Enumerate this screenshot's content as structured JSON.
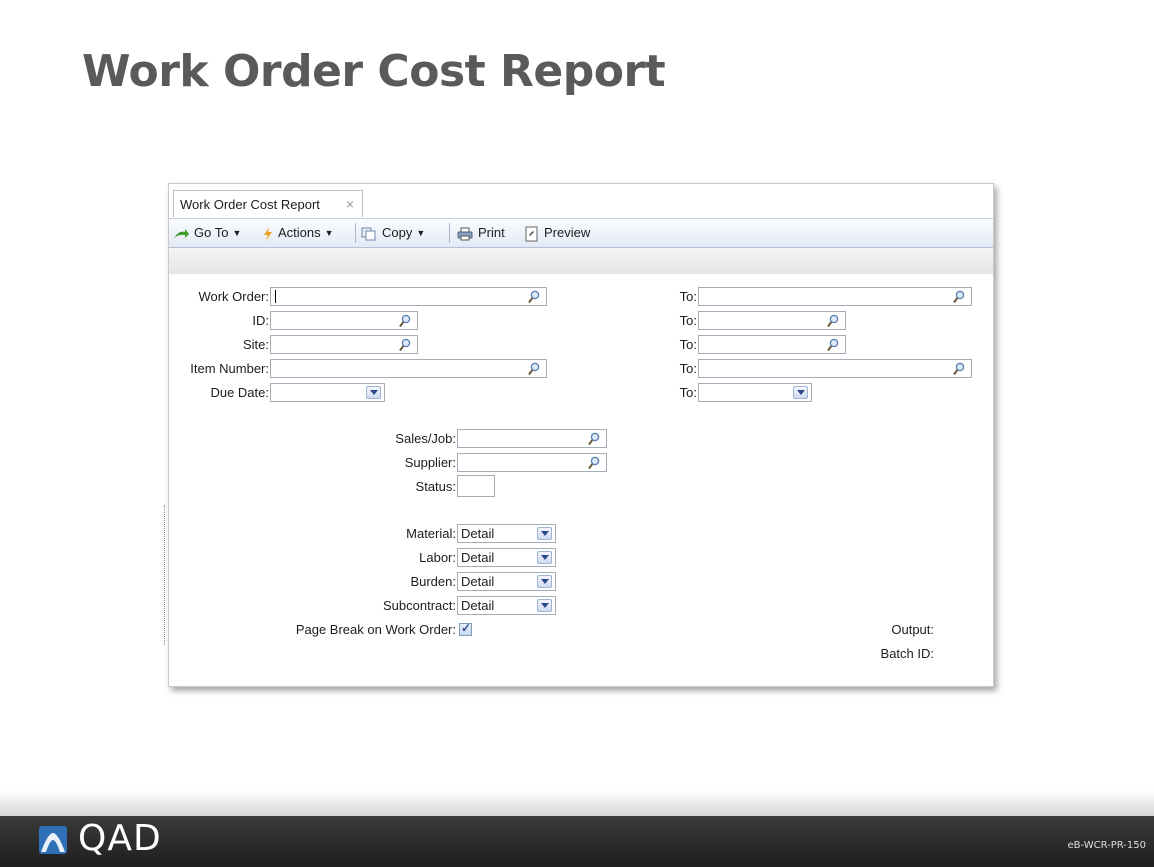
{
  "slide": {
    "title": "Work Order Cost Report",
    "code": "eB-WCR-PR-150",
    "logo": "QAD"
  },
  "window": {
    "tab_label": "Work Order Cost Report",
    "tab_close": "×",
    "toolbar": {
      "goto": "Go To",
      "actions": "Actions",
      "copy": "Copy",
      "print": "Print",
      "preview": "Preview"
    }
  },
  "form": {
    "work_order": {
      "label": "Work Order:",
      "value": "",
      "to_label": "To:",
      "to_value": ""
    },
    "id": {
      "label": "ID:",
      "value": "",
      "to_label": "To:",
      "to_value": ""
    },
    "site": {
      "label": "Site:",
      "value": "",
      "to_label": "To:",
      "to_value": ""
    },
    "item_number": {
      "label": "Item Number:",
      "value": "",
      "to_label": "To:",
      "to_value": ""
    },
    "due_date": {
      "label": "Due Date:",
      "value": "",
      "to_label": "To:",
      "to_value": ""
    },
    "sales_job": {
      "label": "Sales/Job:",
      "value": ""
    },
    "supplier": {
      "label": "Supplier:",
      "value": ""
    },
    "status": {
      "label": "Status:",
      "value": ""
    },
    "material": {
      "label": "Material:",
      "value": "Detail"
    },
    "labor": {
      "label": "Labor:",
      "value": "Detail"
    },
    "burden": {
      "label": "Burden:",
      "value": "Detail"
    },
    "subcontract": {
      "label": "Subcontract:",
      "value": "Detail"
    },
    "page_break": {
      "label": "Page Break on Work Order:",
      "checked": true
    },
    "output": {
      "label": "Output:"
    },
    "batch_id": {
      "label": "Batch ID:"
    }
  }
}
